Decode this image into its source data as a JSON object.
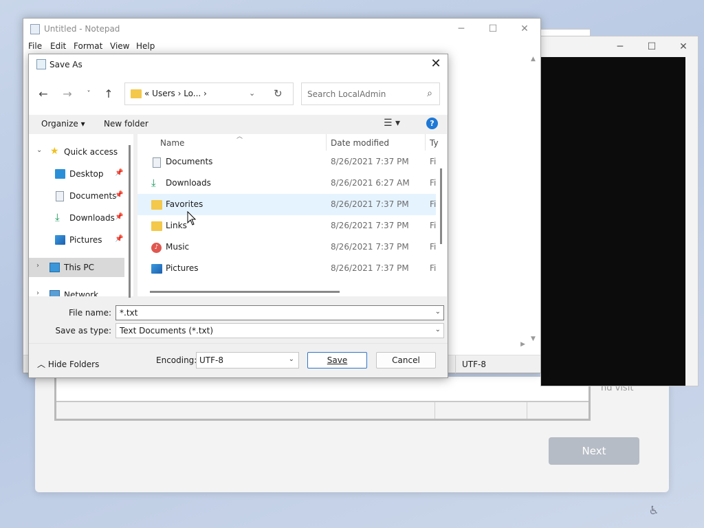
{
  "setup": {
    "tail_text": "nd visit",
    "next_label": "Next"
  },
  "notepad": {
    "title": "Untitled - Notepad",
    "menu": [
      "File",
      "Edit",
      "Format",
      "View",
      "Help"
    ],
    "status_encoding": "UTF-8"
  },
  "dialog": {
    "title": "Save As",
    "address": {
      "crumbs": "« Users  ›  Lo...  ›"
    },
    "search_placeholder": "Search LocalAdmin",
    "commands": {
      "organize": "Organize ▾",
      "new_folder": "New folder"
    },
    "nav_pane": [
      {
        "label": "Quick access",
        "icon": "star-icon"
      },
      {
        "label": "Desktop",
        "icon": "desktop-icon",
        "pinned": true
      },
      {
        "label": "Documents",
        "icon": "documents-icon",
        "pinned": true
      },
      {
        "label": "Downloads",
        "icon": "downloads-icon",
        "pinned": true
      },
      {
        "label": "Pictures",
        "icon": "pictures-icon",
        "pinned": true
      },
      {
        "label": "This PC",
        "icon": "computer-icon",
        "selected": true
      },
      {
        "label": "Network",
        "icon": "network-icon"
      }
    ],
    "columns": {
      "name": "Name",
      "date": "Date modified",
      "type": "Ty"
    },
    "files": [
      {
        "name": "Documents",
        "date": "8/26/2021 7:37 PM",
        "type": "Fi",
        "icon": "documents-icon"
      },
      {
        "name": "Downloads",
        "date": "8/26/2021 6:27 AM",
        "type": "Fi",
        "icon": "downloads-icon"
      },
      {
        "name": "Favorites",
        "date": "8/26/2021 7:37 PM",
        "type": "Fi",
        "icon": "folder-icon",
        "hover": true
      },
      {
        "name": "Links",
        "date": "8/26/2021 7:37 PM",
        "type": "Fi",
        "icon": "folder-icon"
      },
      {
        "name": "Music",
        "date": "8/26/2021 7:37 PM",
        "type": "Fi",
        "icon": "music-icon"
      },
      {
        "name": "Pictures",
        "date": "8/26/2021 7:37 PM",
        "type": "Fi",
        "icon": "pictures-icon"
      }
    ],
    "file_name_label": "File name:",
    "file_name_value": "*.txt",
    "save_type_label": "Save as type:",
    "save_type_value": "Text Documents (*.txt)",
    "hide_folders": "Hide Folders",
    "encoding_label": "Encoding:",
    "encoding_value": "UTF-8",
    "save_label": "Save",
    "cancel_label": "Cancel"
  },
  "colors": {
    "accent": "#1e78d6",
    "hover_row": "#e5f3ff",
    "folder": "#f3c84b"
  }
}
